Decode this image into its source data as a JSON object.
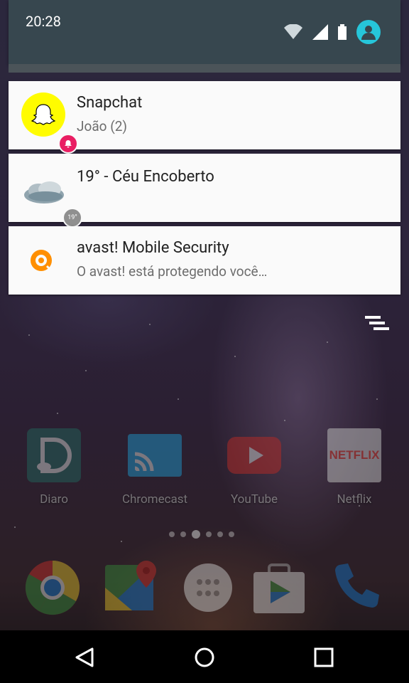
{
  "status_bar": {
    "time": "20:28",
    "icons": [
      "wifi-icon",
      "signal-icon",
      "battery-icon",
      "avatar-icon"
    ],
    "accent": "#26c6da"
  },
  "notifications": [
    {
      "app": "Snapchat",
      "title": "Snapchat",
      "text": "João (2)",
      "icon": "snapchat-ghost-icon",
      "badge": "bell-icon",
      "color": "#fffc00"
    },
    {
      "app": "Weather",
      "title": "19° -  Céu Encoberto",
      "text": "",
      "icon": "cloud-icon",
      "badge": "19°"
    },
    {
      "app": "avast",
      "title": "avast! Mobile Security",
      "text": "O avast! está protegendo você…",
      "icon": "avast-icon",
      "color": "#ff7800"
    }
  ],
  "dismiss_all_icon": "clear-all-icon",
  "home": {
    "apps": [
      {
        "label": "Diaro",
        "icon": "diaro-icon"
      },
      {
        "label": "Chromecast",
        "icon": "chromecast-icon"
      },
      {
        "label": "YouTube",
        "icon": "youtube-icon"
      },
      {
        "label": "Netflix",
        "icon": "netflix-icon",
        "text": "NETFLIX"
      }
    ],
    "page_count": 6,
    "active_page": 3,
    "dock": [
      "chrome-icon",
      "maps-icon",
      "app-drawer-icon",
      "play-store-icon",
      "phone-icon"
    ]
  },
  "navbar": [
    "back-icon",
    "home-icon",
    "recents-icon"
  ]
}
